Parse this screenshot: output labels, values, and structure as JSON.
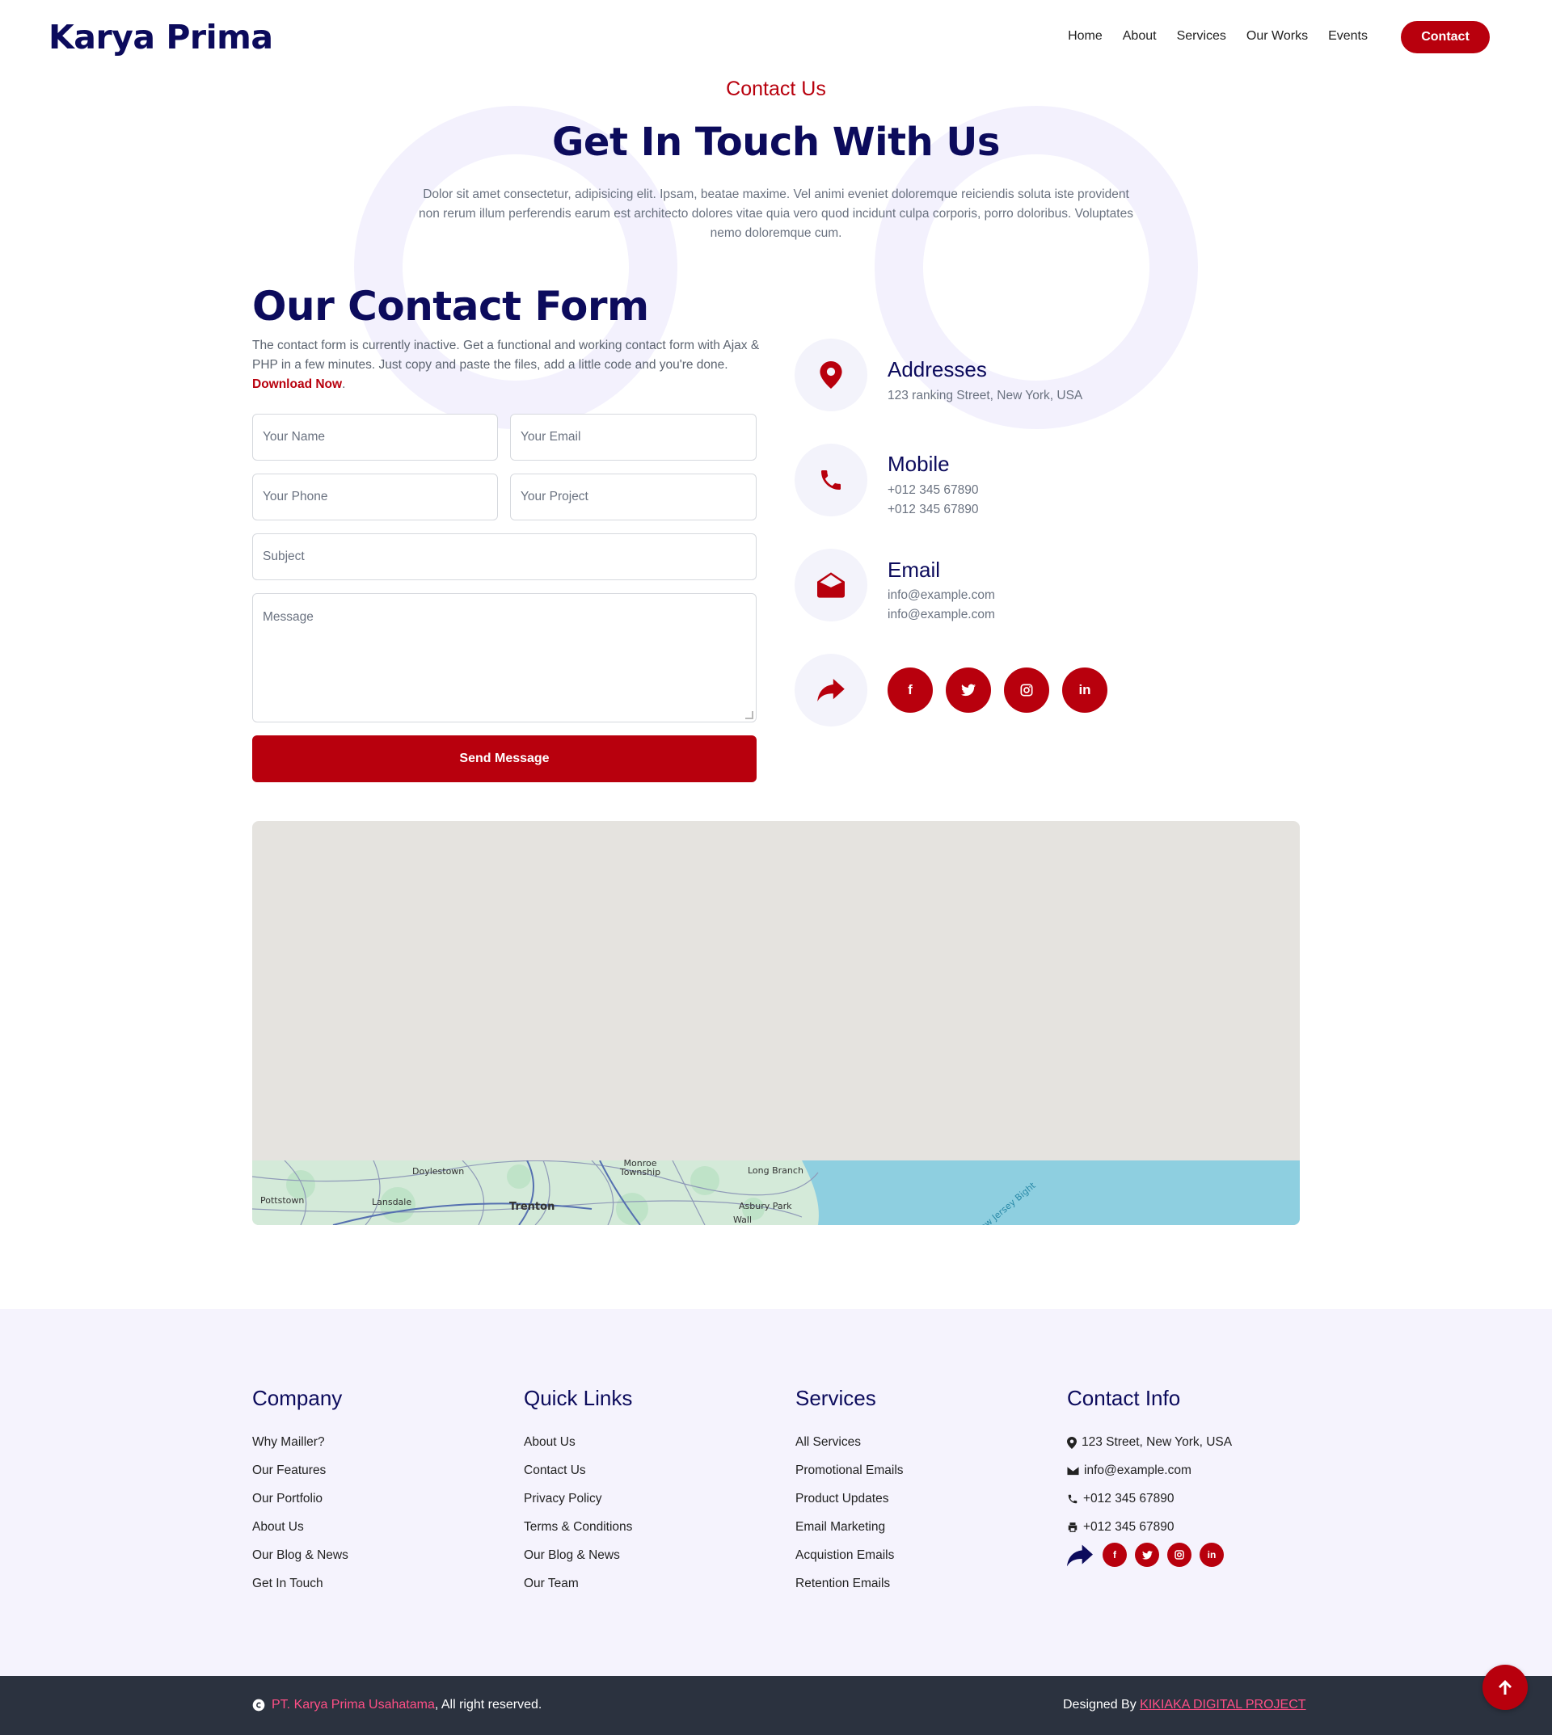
{
  "header": {
    "brand": "Karya Prima",
    "nav": [
      "Home",
      "About",
      "Services",
      "Our Works",
      "Events"
    ],
    "cta": "Contact"
  },
  "hero": {
    "eyebrow": "Contact Us",
    "title": "Get In Touch With Us",
    "description": "Dolor sit amet consectetur, adipisicing elit. Ipsam, beatae maxime. Vel animi eveniet doloremque reiciendis soluta iste provident non rerum illum perferendis earum est architecto dolores vitae quia vero quod incidunt culpa corporis, porro doloribus. Voluptates nemo doloremque cum."
  },
  "form": {
    "title": "Our Contact Form",
    "description": "The contact form is currently inactive. Get a functional and working contact form with Ajax & PHP in a few minutes. Just copy and paste the files, add a little code and you're done.",
    "download_link": "Download Now",
    "name_placeholder": "Your Name",
    "email_placeholder": "Your Email",
    "phone_placeholder": "Your Phone",
    "project_placeholder": "Your Project",
    "subject_placeholder": "Subject",
    "message_placeholder": "Message",
    "submit": "Send Message"
  },
  "info": {
    "address_title": "Addresses",
    "address_line": "123 ranking Street, New York, USA",
    "mobile_title": "Mobile",
    "mobile_1": "+012 345 67890",
    "mobile_2": "+012 345 67890",
    "email_title": "Email",
    "email_1": "info@example.com",
    "email_2": "info@example.com",
    "social_icons": [
      "facebook-icon",
      "twitter-icon",
      "instagram-icon",
      "linkedin-icon"
    ]
  },
  "map": {
    "labels": [
      "Pottstown",
      "Lansdale",
      "Doylestown",
      "Trenton",
      "Monroe Township",
      "Long Branch",
      "Asbury Park",
      "Wall",
      "New Jersey Bight"
    ]
  },
  "footer": {
    "company": {
      "title": "Company",
      "links": [
        "Why Mailler?",
        "Our Features",
        "Our Portfolio",
        "About Us",
        "Our Blog & News",
        "Get In Touch"
      ]
    },
    "quick_links": {
      "title": "Quick Links",
      "links": [
        "About Us",
        "Contact Us",
        "Privacy Policy",
        "Terms & Conditions",
        "Our Blog & News",
        "Our Team"
      ]
    },
    "services": {
      "title": "Services",
      "links": [
        "All Services",
        "Promotional Emails",
        "Product Updates",
        "Email Marketing",
        "Acquistion Emails",
        "Retention Emails"
      ]
    },
    "contact": {
      "title": "Contact Info",
      "address": "123 Street, New York, USA",
      "email": "info@example.com",
      "phone": "+012 345 67890",
      "fax": "+012 345 67890"
    }
  },
  "bottom": {
    "company": "PT. Karya Prima Usahatama",
    "rights": ", All right reserved.",
    "designed_prefix": "Designed By ",
    "designer": "KIKIAKA DIGITAL PROJECT"
  },
  "colors": {
    "primary": "#b8000d",
    "navy": "#0c0b5c",
    "footer_bg": "#f5f3fd",
    "bottom_bg": "#2b323f",
    "accent_pink": "#ff4f86"
  }
}
